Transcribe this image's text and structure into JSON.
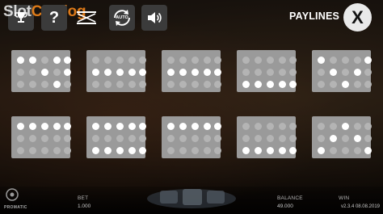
{
  "watermark": {
    "part1": "Slot",
    "part2": "Catalog"
  },
  "header": {
    "title": "PAYLINES",
    "close_label": "X",
    "buttons": [
      {
        "name": "trophy-button",
        "icon": "trophy-icon"
      },
      {
        "name": "help-button",
        "label": "?",
        "icon": "question-icon"
      },
      {
        "name": "sound-toggle",
        "icon": "mute-icon"
      },
      {
        "name": "autoplay-button",
        "label": "AUTO",
        "icon": "auto-icon"
      },
      {
        "name": "volume-button",
        "icon": "speaker-icon"
      }
    ]
  },
  "paylines": [
    {
      "pattern": [
        1,
        1,
        0,
        1,
        1,
        0,
        0,
        1,
        0,
        1,
        0,
        0,
        0,
        1,
        0
      ]
    },
    {
      "pattern": [
        0,
        0,
        0,
        0,
        0,
        1,
        1,
        1,
        1,
        1,
        0,
        0,
        0,
        0,
        0
      ]
    },
    {
      "pattern": [
        0,
        0,
        0,
        0,
        0,
        1,
        1,
        1,
        1,
        1,
        0,
        0,
        0,
        0,
        0
      ]
    },
    {
      "pattern": [
        0,
        0,
        0,
        0,
        0,
        0,
        0,
        0,
        0,
        0,
        1,
        1,
        1,
        1,
        1
      ]
    },
    {
      "pattern": [
        1,
        0,
        0,
        0,
        1,
        0,
        1,
        0,
        1,
        0,
        0,
        0,
        1,
        0,
        0
      ]
    },
    {
      "pattern": [
        1,
        1,
        1,
        1,
        1,
        0,
        0,
        0,
        0,
        0,
        0,
        0,
        0,
        0,
        0
      ]
    },
    {
      "pattern": [
        1,
        1,
        1,
        1,
        1,
        0,
        0,
        0,
        0,
        0,
        1,
        1,
        1,
        1,
        1
      ]
    },
    {
      "pattern": [
        1,
        1,
        1,
        1,
        1,
        0,
        0,
        0,
        0,
        0,
        0,
        0,
        0,
        0,
        0
      ]
    },
    {
      "pattern": [
        0,
        0,
        0,
        0,
        0,
        0,
        0,
        0,
        0,
        0,
        1,
        1,
        1,
        1,
        1
      ]
    },
    {
      "pattern": [
        0,
        0,
        1,
        0,
        0,
        0,
        1,
        0,
        1,
        0,
        1,
        0,
        0,
        0,
        1
      ]
    }
  ],
  "footer": {
    "bet_label": "BET",
    "bet_value": "1.000",
    "balance_label": "BALANCE",
    "balance_value": "49.000",
    "win_label": "WIN",
    "brand": "PROMATIC",
    "version": "v2.3.4 08.08.2019"
  },
  "colors": {
    "card": "#9a9a9a",
    "dot_on": "#ffffff",
    "dot_off": "#b4b4b4",
    "accent": "#ff8c1a"
  }
}
